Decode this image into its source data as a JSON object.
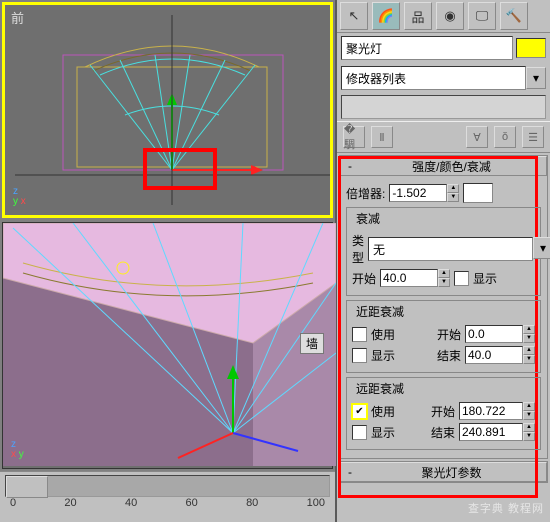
{
  "viewport_top_label": "前",
  "viewport_bot_label": "墙",
  "axis": {
    "x": "x",
    "y": "y",
    "z": "z"
  },
  "timeline": {
    "ticks": [
      "0",
      "20",
      "40",
      "60",
      "80",
      "100"
    ]
  },
  "panel": {
    "object_name": "聚光灯",
    "modifier_list": "修改器列表",
    "rollout_intensity": "强度/颜色/衰减",
    "multiplier_label": "倍增器:",
    "multiplier_value": "-1.502",
    "decay_group": "衰减",
    "type_label": "类型",
    "type_value": "无",
    "start_label": "开始",
    "start_value": "40.0",
    "show_label": "显示",
    "near_group": "近距衰减",
    "use_label": "使用",
    "near_start": "0.0",
    "end_label": "结束",
    "near_end": "40.0",
    "far_group": "远距衰减",
    "far_start": "180.722",
    "far_end": "240.891",
    "rollout_spot": "聚光灯参数"
  },
  "watermark": "查字典  教程网"
}
